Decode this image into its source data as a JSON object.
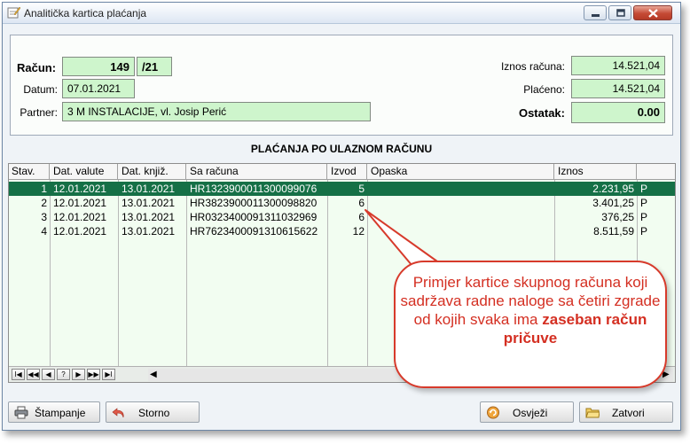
{
  "window": {
    "title": "Analitička kartica plaćanja"
  },
  "header": {
    "racun_label": "Račun:",
    "racun_number": "149",
    "racun_suffix": "/21",
    "datum_label": "Datum:",
    "datum_value": "07.01.2021",
    "partner_label": "Partner:",
    "partner_value": "3 M INSTALACIJE, vl. Josip Perić",
    "iznos_label": "Iznos računa:",
    "iznos_value": "14.521,04",
    "placeno_label": "Plaćeno:",
    "placeno_value": "14.521,04",
    "ostatak_label": "Ostatak:",
    "ostatak_value": "0.00"
  },
  "section_title": "PLAĆANJA PO ULAZNOM RAČUNU",
  "table": {
    "columns": [
      "Stav.",
      "Dat. valute",
      "Dat. knjiž.",
      "Sa računa",
      "Izvod",
      "Opaska",
      "Iznos"
    ],
    "rows": [
      [
        "1",
        "12.01.2021",
        "13.01.2021",
        "HR1323900011300099076",
        "5",
        "",
        "2.231,95",
        "P"
      ],
      [
        "2",
        "12.01.2021",
        "13.01.2021",
        "HR3823900011300098820",
        "6",
        "",
        "3.401,25",
        "P"
      ],
      [
        "3",
        "12.01.2021",
        "13.01.2021",
        "HR0323400091311032969",
        "6",
        "",
        "376,25",
        "P"
      ],
      [
        "4",
        "12.01.2021",
        "13.01.2021",
        "HR7623400091310615622",
        "12",
        "",
        "8.511,59",
        "P"
      ]
    ]
  },
  "navigator": [
    "I◀",
    "◀◀",
    "◀",
    "?",
    "▶",
    "▶▶",
    "▶I"
  ],
  "buttons": {
    "print": "Štampanje",
    "storno": "Storno",
    "refresh": "Osvježi",
    "close": "Zatvori"
  },
  "callout": {
    "text_part1": "Primjer kartice skupnog računa koji sadržava radne naloge sa četiri zgrade od kojih svaka ima ",
    "text_bold": "zaseban račun pričuve"
  },
  "colors": {
    "field_bg": "#cef5cc",
    "selected_row": "#157046",
    "callout_red": "#d73a2b"
  },
  "icons": [
    "app-icon",
    "minimize-icon",
    "maximize-icon",
    "close-icon",
    "printer-icon",
    "undo-icon",
    "refresh-icon",
    "folder-icon"
  ]
}
